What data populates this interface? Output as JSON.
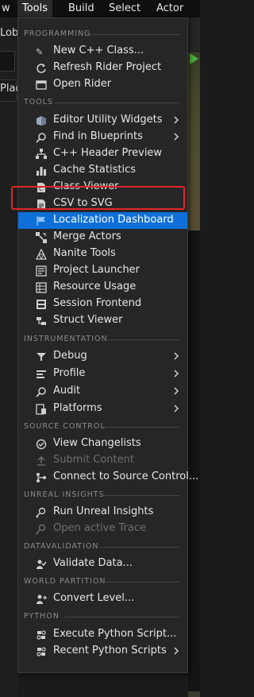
{
  "menubar": {
    "items": [
      "w",
      "Tools",
      "Build",
      "Select",
      "Actor"
    ],
    "active": "Tools"
  },
  "editor": {
    "left_tab_label": "Lob",
    "left_panel_label": "Plac"
  },
  "menu": {
    "sections": [
      {
        "title": "PROGRAMMING",
        "items": [
          {
            "label": "New C++ Class...",
            "icon": "cpp-class-icon"
          },
          {
            "label": "Refresh Rider Project",
            "icon": "refresh-icon"
          },
          {
            "label": "Open Rider",
            "icon": "ide-icon"
          }
        ]
      },
      {
        "title": "TOOLS",
        "items": [
          {
            "label": "Editor Utility Widgets",
            "icon": "widget-icon",
            "submenu": true
          },
          {
            "label": "Find in Blueprints",
            "icon": "search-icon",
            "submenu": true
          },
          {
            "label": "C++ Header Preview",
            "icon": "hierarchy-icon"
          },
          {
            "label": "Cache Statistics",
            "icon": "bar-chart-icon"
          },
          {
            "label": "Class Viewer",
            "icon": "class-viewer-icon"
          },
          {
            "label": "CSV to SVG",
            "icon": "csv-icon"
          },
          {
            "label": "Localization Dashboard",
            "icon": "flag-icon",
            "highlighted": true
          },
          {
            "label": "Merge Actors",
            "icon": "merge-icon"
          },
          {
            "label": "Nanite Tools",
            "icon": "nanite-icon"
          },
          {
            "label": "Project Launcher",
            "icon": "launcher-icon"
          },
          {
            "label": "Resource Usage",
            "icon": "table-icon"
          },
          {
            "label": "Session Frontend",
            "icon": "session-icon"
          },
          {
            "label": "Struct Viewer",
            "icon": "struct-icon"
          }
        ]
      },
      {
        "title": "INSTRUMENTATION",
        "items": [
          {
            "label": "Debug",
            "icon": "bug-icon",
            "submenu": true
          },
          {
            "label": "Profile",
            "icon": "profile-icon",
            "submenu": true
          },
          {
            "label": "Audit",
            "icon": "audit-icon",
            "submenu": true
          },
          {
            "label": "Platforms",
            "icon": "platforms-icon",
            "submenu": true
          }
        ]
      },
      {
        "title": "SOURCE CONTROL",
        "items": [
          {
            "label": "View Changelists",
            "icon": "check-circle-icon"
          },
          {
            "label": "Submit Content",
            "icon": "upload-icon",
            "disabled": true
          },
          {
            "label": "Connect to Source Control...",
            "icon": "connect-icon"
          }
        ]
      },
      {
        "title": "UNREAL INSIGHTS",
        "items": [
          {
            "label": "Run Unreal Insights",
            "icon": "insights-icon"
          },
          {
            "label": "Open active Trace",
            "icon": "trace-icon",
            "disabled": true
          }
        ]
      },
      {
        "title": "DATAVALIDATION",
        "items": [
          {
            "label": "Validate Data...",
            "icon": "validate-icon"
          }
        ]
      },
      {
        "title": "WORLD PARTITION",
        "items": [
          {
            "label": "Convert Level...",
            "icon": "convert-icon"
          }
        ]
      },
      {
        "title": "PYTHON",
        "items": [
          {
            "label": "Execute Python Script...",
            "icon": "python-run-icon"
          },
          {
            "label": "Recent Python Scripts",
            "icon": "python-recent-icon",
            "submenu": true
          }
        ]
      }
    ]
  },
  "colors": {
    "highlight": "#0f6fd8",
    "annotation": "#e0262a",
    "menu_bg": "#262626",
    "play": "#4caf3a"
  }
}
